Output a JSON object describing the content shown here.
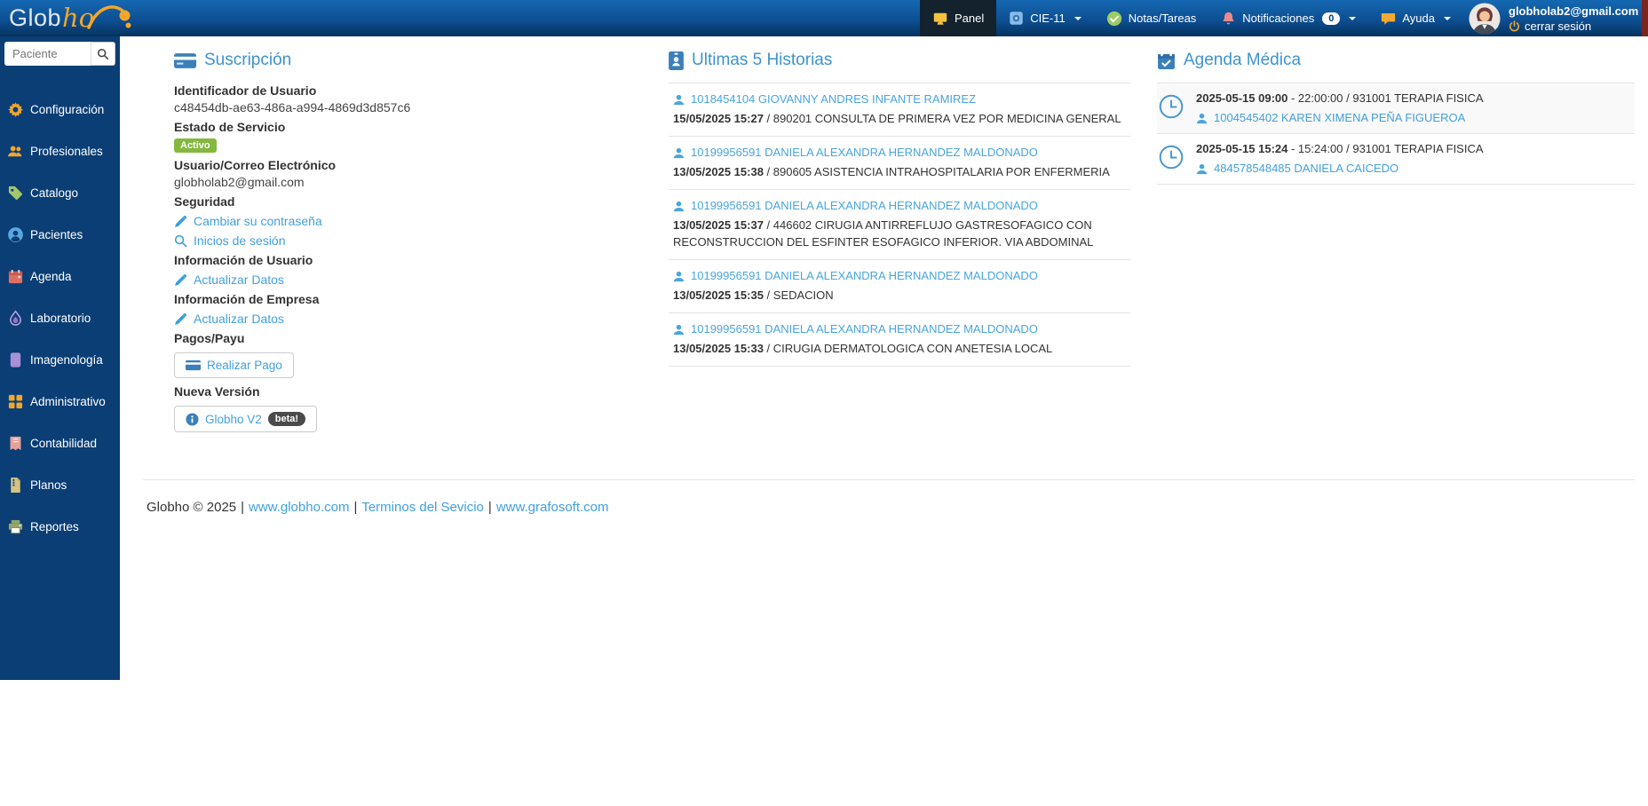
{
  "colors": {
    "navbar_top": "#1568b2",
    "navbar_bottom": "#063360",
    "sidebar_bg": "#0a3e75",
    "accent_blue": "#3d93ce",
    "link_blue": "#42a0dc",
    "badge_green": "#84b83e",
    "logo_orange": "#f4a62a"
  },
  "navbar": {
    "logo": {
      "part1": "Glob",
      "part2": "ho"
    },
    "items": [
      {
        "label": "Panel"
      },
      {
        "label": "CIE-11"
      },
      {
        "label": "Notas/Tareas"
      },
      {
        "label": "Notificaciones",
        "badge": "0"
      },
      {
        "label": "Ayuda"
      }
    ],
    "user": {
      "email": "globholab2@gmail.com",
      "logout_label": "cerrar sesión"
    }
  },
  "sidebar": {
    "search_placeholder": "Paciente",
    "items": [
      {
        "label": "Configuración"
      },
      {
        "label": "Profesionales"
      },
      {
        "label": "Catalogo"
      },
      {
        "label": "Pacientes"
      },
      {
        "label": "Agenda"
      },
      {
        "label": "Laboratorio"
      },
      {
        "label": "Imagenología"
      },
      {
        "label": "Administrativo"
      },
      {
        "label": "Contabilidad"
      },
      {
        "label": "Planos"
      },
      {
        "label": "Reportes"
      }
    ]
  },
  "subscription": {
    "title": "Suscripción",
    "user_id_label": "Identificador de Usuario",
    "user_id": "c48454db-ae63-486a-a994-4869d3d857c6",
    "service_status_label": "Estado de Servicio",
    "status_badge": "Activo",
    "email_label": "Usuario/Correo Electrónico",
    "email": "globholab2@gmail.com",
    "security_label": "Seguridad",
    "change_password": "Cambiar su contraseña",
    "logins": "Inicios de sesión",
    "user_info_label": "Información de Usuario",
    "update_user": "Actualizar Datos",
    "company_info_label": "Información de Empresa",
    "update_company": "Actualizar Datos",
    "payments_label": "Pagos/Payu",
    "pay_button": "Realizar Pago",
    "new_version_label": "Nueva Versión",
    "v2_button": "Globho V2",
    "beta_badge": "beta!"
  },
  "histories": {
    "title": "Ultimas 5 Historias",
    "items": [
      {
        "patient": "1018454104 GIOVANNY ANDRES INFANTE RAMIREZ",
        "date": "15/05/2025 15:27",
        "desc": " / 890201 CONSULTA DE PRIMERA VEZ POR MEDICINA GENERAL"
      },
      {
        "patient": "10199956591 DANIELA ALEXANDRA HERNANDEZ MALDONADO",
        "date": "13/05/2025 15:38",
        "desc": " / 890605 ASISTENCIA INTRAHOSPITALARIA POR ENFERMERIA"
      },
      {
        "patient": "10199956591 DANIELA ALEXANDRA HERNANDEZ MALDONADO",
        "date": "13/05/2025 15:37",
        "desc": " / 446602 CIRUGIA ANTIRREFLUJO GASTRESOFAGICO CON RECONSTRUCCION DEL ESFINTER ESOFAGICO INFERIOR. VIA ABDOMINAL"
      },
      {
        "patient": "10199956591 DANIELA ALEXANDRA HERNANDEZ MALDONADO",
        "date": "13/05/2025 15:35",
        "desc": " / SEDACION"
      },
      {
        "patient": "10199956591 DANIELA ALEXANDRA HERNANDEZ MALDONADO",
        "date": "13/05/2025 15:33",
        "desc": " / CIRUGIA DERMATOLOGICA CON ANETESIA LOCAL"
      }
    ]
  },
  "agenda": {
    "title": "Agenda Médica",
    "items": [
      {
        "time": "2025-05-15 09:00",
        "rest": " - 22:00:00 / 931001 TERAPIA FISICA",
        "patient": "1004545402 KAREN XIMENA PEÑA FIGUEROA"
      },
      {
        "time": "2025-05-15 15:24",
        "rest": " - 15:24:00 / 931001 TERAPIA FISICA",
        "patient": "484578548485 DANIELA CAICEDO"
      }
    ]
  },
  "footer": {
    "copyright": "Globho © 2025",
    "sep": "|",
    "links": [
      {
        "label": "www.globho.com"
      },
      {
        "label": "Terminos del Sevicio"
      },
      {
        "label": "www.grafosoft.com"
      }
    ]
  }
}
